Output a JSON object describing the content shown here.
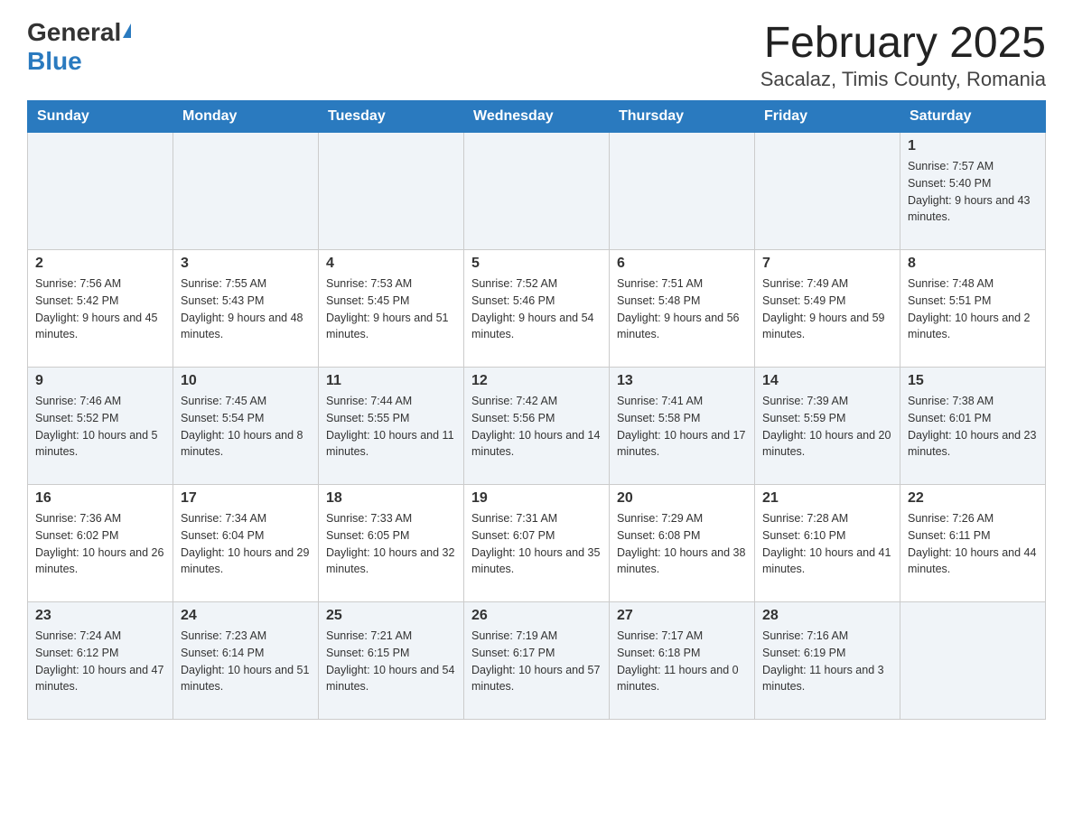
{
  "header": {
    "logo_general": "General",
    "logo_blue": "Blue",
    "month_title": "February 2025",
    "location": "Sacalaz, Timis County, Romania"
  },
  "weekdays": [
    "Sunday",
    "Monday",
    "Tuesday",
    "Wednesday",
    "Thursday",
    "Friday",
    "Saturday"
  ],
  "rows": [
    [
      {
        "day": "",
        "info": ""
      },
      {
        "day": "",
        "info": ""
      },
      {
        "day": "",
        "info": ""
      },
      {
        "day": "",
        "info": ""
      },
      {
        "day": "",
        "info": ""
      },
      {
        "day": "",
        "info": ""
      },
      {
        "day": "1",
        "info": "Sunrise: 7:57 AM\nSunset: 5:40 PM\nDaylight: 9 hours and 43 minutes."
      }
    ],
    [
      {
        "day": "2",
        "info": "Sunrise: 7:56 AM\nSunset: 5:42 PM\nDaylight: 9 hours and 45 minutes."
      },
      {
        "day": "3",
        "info": "Sunrise: 7:55 AM\nSunset: 5:43 PM\nDaylight: 9 hours and 48 minutes."
      },
      {
        "day": "4",
        "info": "Sunrise: 7:53 AM\nSunset: 5:45 PM\nDaylight: 9 hours and 51 minutes."
      },
      {
        "day": "5",
        "info": "Sunrise: 7:52 AM\nSunset: 5:46 PM\nDaylight: 9 hours and 54 minutes."
      },
      {
        "day": "6",
        "info": "Sunrise: 7:51 AM\nSunset: 5:48 PM\nDaylight: 9 hours and 56 minutes."
      },
      {
        "day": "7",
        "info": "Sunrise: 7:49 AM\nSunset: 5:49 PM\nDaylight: 9 hours and 59 minutes."
      },
      {
        "day": "8",
        "info": "Sunrise: 7:48 AM\nSunset: 5:51 PM\nDaylight: 10 hours and 2 minutes."
      }
    ],
    [
      {
        "day": "9",
        "info": "Sunrise: 7:46 AM\nSunset: 5:52 PM\nDaylight: 10 hours and 5 minutes."
      },
      {
        "day": "10",
        "info": "Sunrise: 7:45 AM\nSunset: 5:54 PM\nDaylight: 10 hours and 8 minutes."
      },
      {
        "day": "11",
        "info": "Sunrise: 7:44 AM\nSunset: 5:55 PM\nDaylight: 10 hours and 11 minutes."
      },
      {
        "day": "12",
        "info": "Sunrise: 7:42 AM\nSunset: 5:56 PM\nDaylight: 10 hours and 14 minutes."
      },
      {
        "day": "13",
        "info": "Sunrise: 7:41 AM\nSunset: 5:58 PM\nDaylight: 10 hours and 17 minutes."
      },
      {
        "day": "14",
        "info": "Sunrise: 7:39 AM\nSunset: 5:59 PM\nDaylight: 10 hours and 20 minutes."
      },
      {
        "day": "15",
        "info": "Sunrise: 7:38 AM\nSunset: 6:01 PM\nDaylight: 10 hours and 23 minutes."
      }
    ],
    [
      {
        "day": "16",
        "info": "Sunrise: 7:36 AM\nSunset: 6:02 PM\nDaylight: 10 hours and 26 minutes."
      },
      {
        "day": "17",
        "info": "Sunrise: 7:34 AM\nSunset: 6:04 PM\nDaylight: 10 hours and 29 minutes."
      },
      {
        "day": "18",
        "info": "Sunrise: 7:33 AM\nSunset: 6:05 PM\nDaylight: 10 hours and 32 minutes."
      },
      {
        "day": "19",
        "info": "Sunrise: 7:31 AM\nSunset: 6:07 PM\nDaylight: 10 hours and 35 minutes."
      },
      {
        "day": "20",
        "info": "Sunrise: 7:29 AM\nSunset: 6:08 PM\nDaylight: 10 hours and 38 minutes."
      },
      {
        "day": "21",
        "info": "Sunrise: 7:28 AM\nSunset: 6:10 PM\nDaylight: 10 hours and 41 minutes."
      },
      {
        "day": "22",
        "info": "Sunrise: 7:26 AM\nSunset: 6:11 PM\nDaylight: 10 hours and 44 minutes."
      }
    ],
    [
      {
        "day": "23",
        "info": "Sunrise: 7:24 AM\nSunset: 6:12 PM\nDaylight: 10 hours and 47 minutes."
      },
      {
        "day": "24",
        "info": "Sunrise: 7:23 AM\nSunset: 6:14 PM\nDaylight: 10 hours and 51 minutes."
      },
      {
        "day": "25",
        "info": "Sunrise: 7:21 AM\nSunset: 6:15 PM\nDaylight: 10 hours and 54 minutes."
      },
      {
        "day": "26",
        "info": "Sunrise: 7:19 AM\nSunset: 6:17 PM\nDaylight: 10 hours and 57 minutes."
      },
      {
        "day": "27",
        "info": "Sunrise: 7:17 AM\nSunset: 6:18 PM\nDaylight: 11 hours and 0 minutes."
      },
      {
        "day": "28",
        "info": "Sunrise: 7:16 AM\nSunset: 6:19 PM\nDaylight: 11 hours and 3 minutes."
      },
      {
        "day": "",
        "info": ""
      }
    ]
  ]
}
